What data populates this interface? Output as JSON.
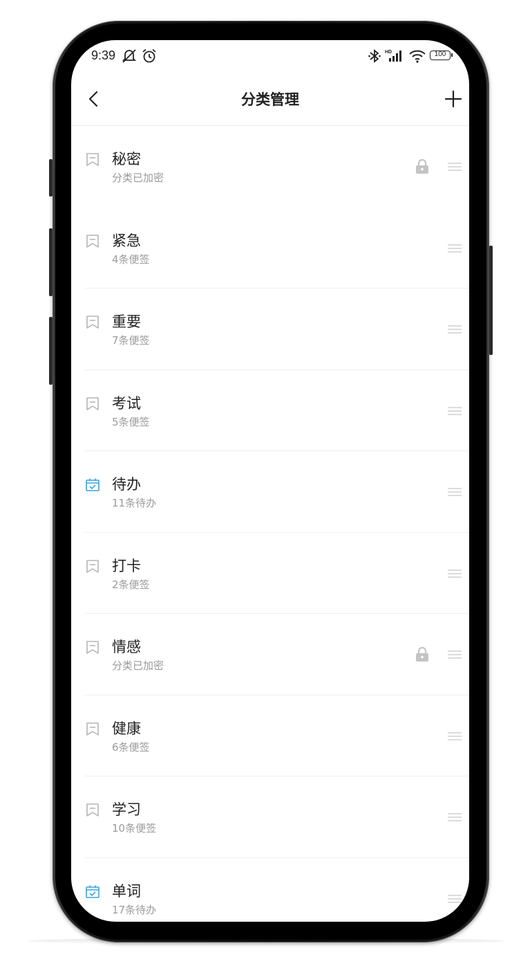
{
  "status_bar": {
    "time": "9:39",
    "battery": "100",
    "icons": [
      "mute-icon",
      "alarm-icon",
      "bluetooth-icon",
      "hd-signal-icon",
      "wifi-icon",
      "battery-icon"
    ]
  },
  "header": {
    "title": "分类管理",
    "back_icon": "chevron-left-icon",
    "add_icon": "plus-icon"
  },
  "categories": [
    {
      "name": "秘密",
      "subtitle": "分类已加密",
      "icon": "bookmark-icon",
      "locked": true
    },
    {
      "name": "紧急",
      "subtitle": "4条便签",
      "icon": "bookmark-icon",
      "locked": false
    },
    {
      "name": "重要",
      "subtitle": "7条便签",
      "icon": "bookmark-icon",
      "locked": false
    },
    {
      "name": "考试",
      "subtitle": "5条便签",
      "icon": "bookmark-icon",
      "locked": false
    },
    {
      "name": "待办",
      "subtitle": "11条待办",
      "icon": "calendar-check-icon",
      "locked": false
    },
    {
      "name": "打卡",
      "subtitle": "2条便签",
      "icon": "bookmark-icon",
      "locked": false
    },
    {
      "name": "情感",
      "subtitle": "分类已加密",
      "icon": "bookmark-icon",
      "locked": true
    },
    {
      "name": "健康",
      "subtitle": "6条便签",
      "icon": "bookmark-icon",
      "locked": false
    },
    {
      "name": "学习",
      "subtitle": "10条便签",
      "icon": "bookmark-icon",
      "locked": false
    },
    {
      "name": "单词",
      "subtitle": "17条待办",
      "icon": "calendar-check-icon",
      "locked": false
    }
  ],
  "colors": {
    "accent": "#3aa3e0",
    "icon_gray": "#b5b5b5",
    "text_primary": "#222222",
    "text_secondary": "#9a9a9a"
  }
}
